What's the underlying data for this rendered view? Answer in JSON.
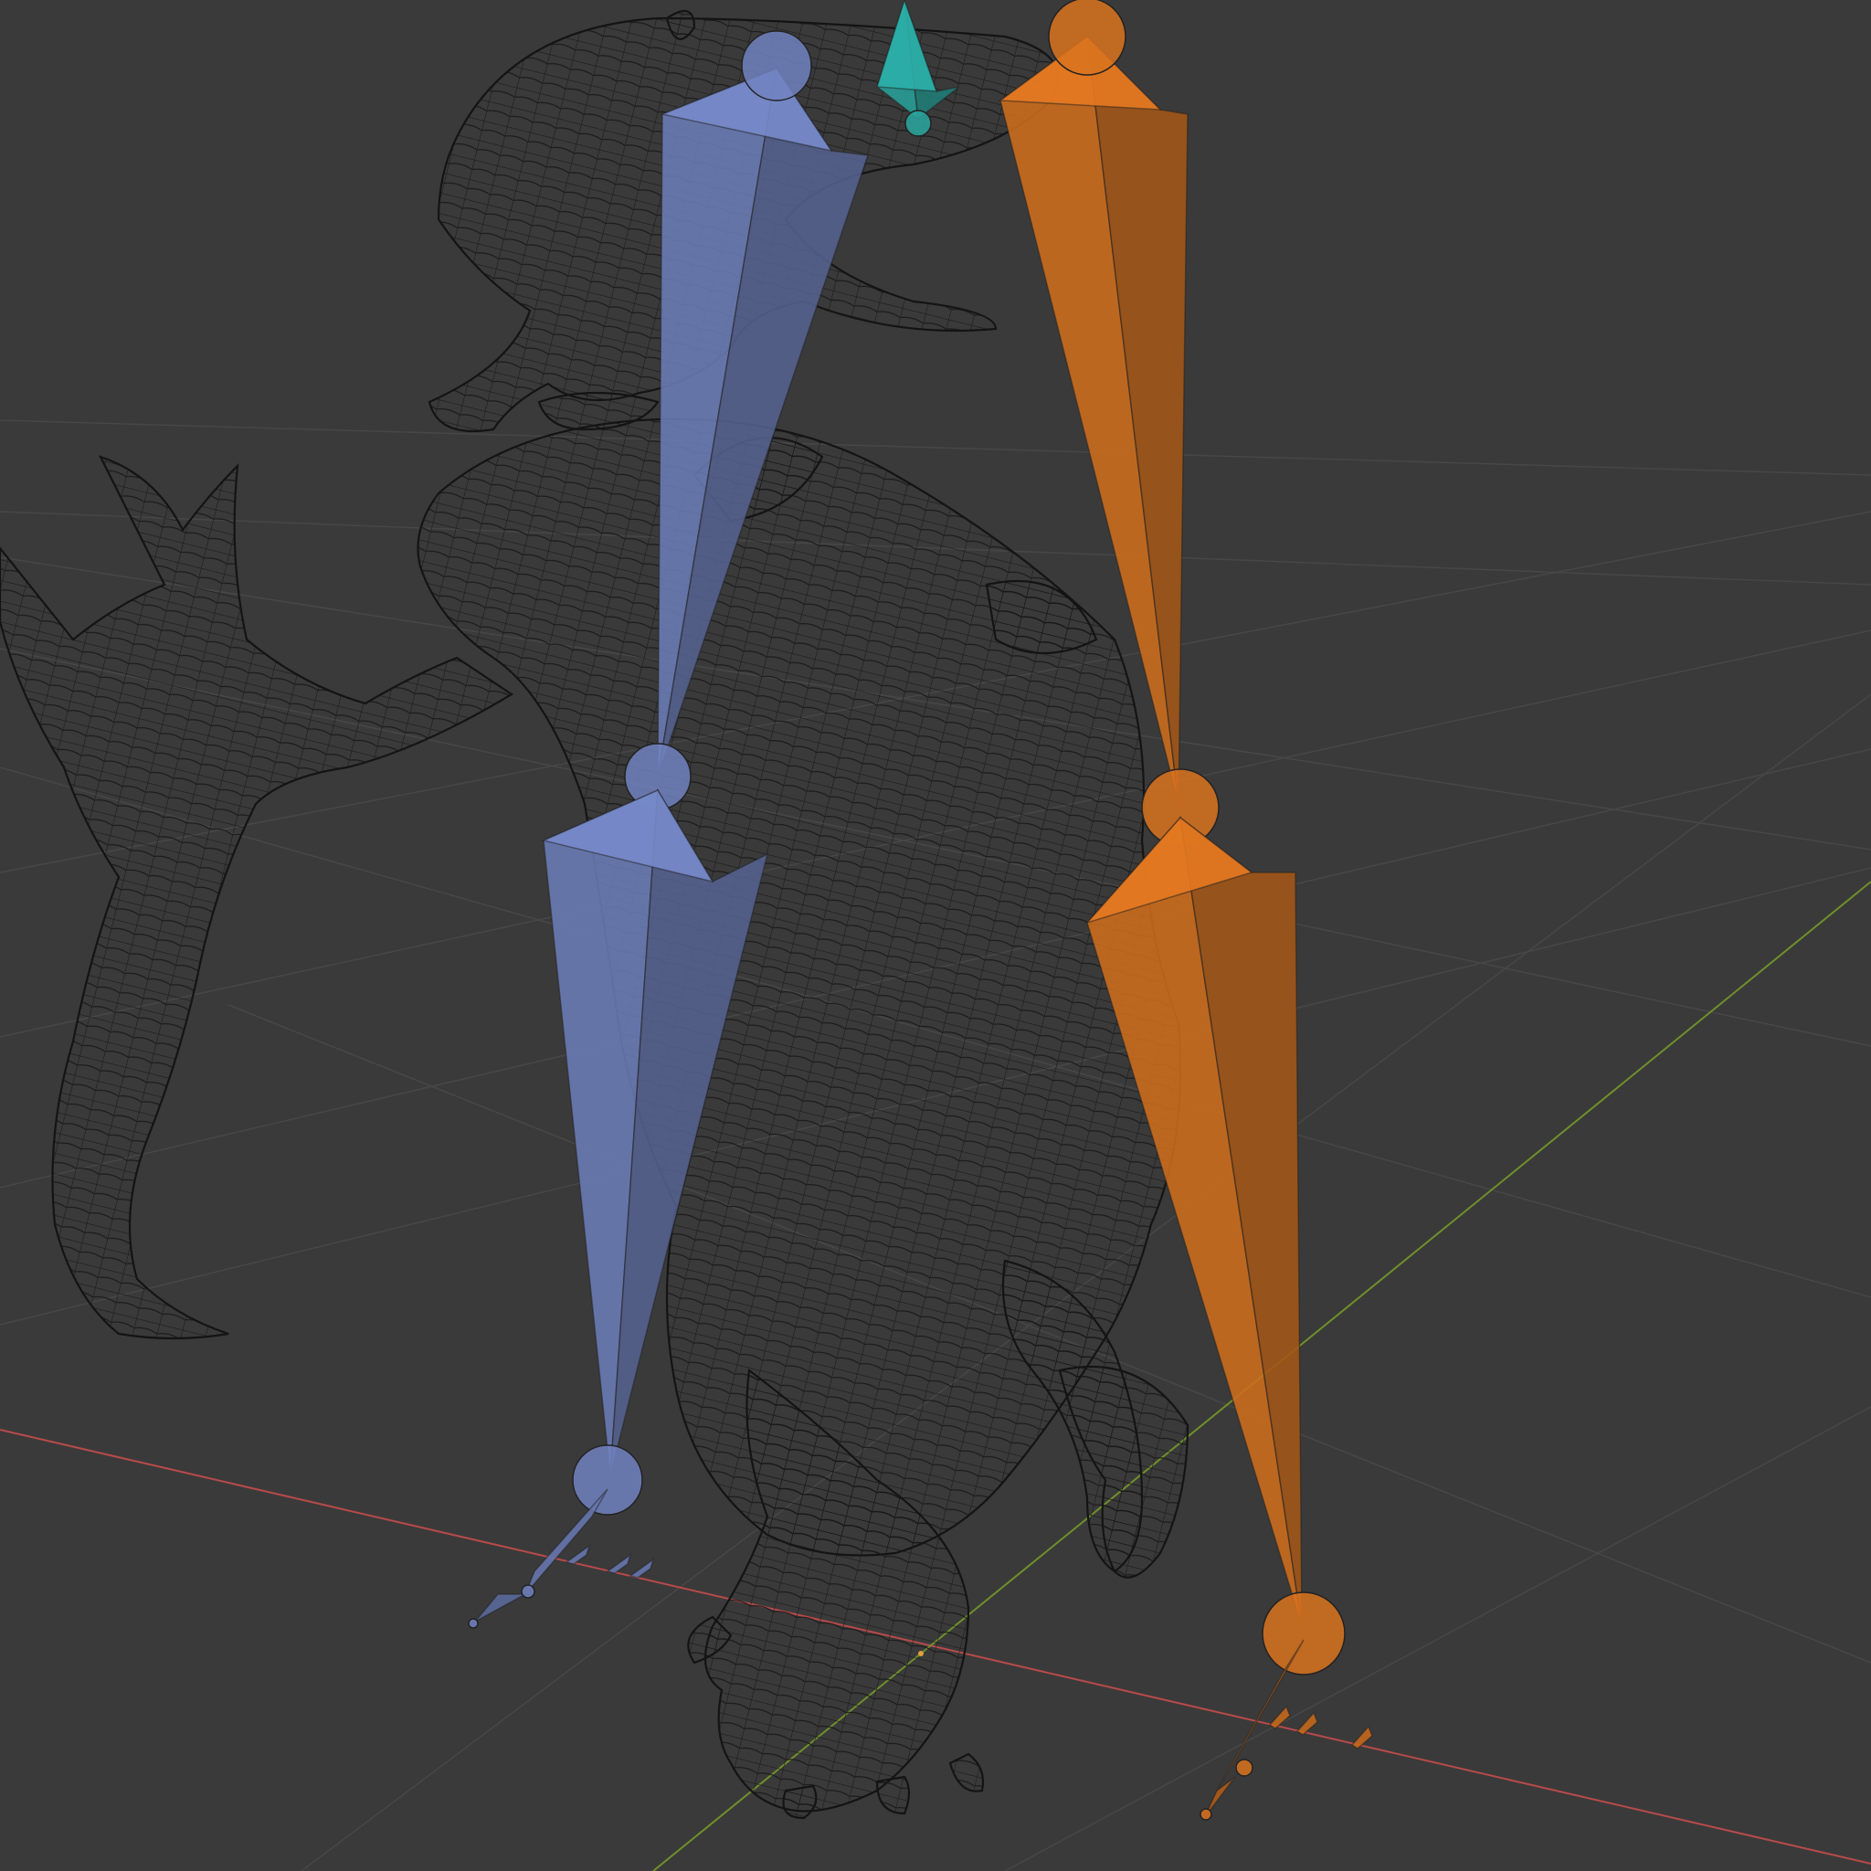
{
  "viewport": {
    "background": "#3a3a3a",
    "grid_color": "#474747",
    "axis_x_color": "#b84a4a",
    "axis_y_color": "#6f8f2a",
    "mesh_color": "#141414"
  },
  "armature": {
    "left_chain_color": "#7183c0",
    "right_chain_color": "#d9731f",
    "root_bone_color": "#2aa7a0",
    "bones": [
      {
        "name": "root-bone",
        "chain": "root"
      },
      {
        "name": "left-thigh-bone",
        "chain": "left"
      },
      {
        "name": "left-shin-bone",
        "chain": "left"
      },
      {
        "name": "left-foot-bone",
        "chain": "left"
      },
      {
        "name": "left-toe-bones",
        "chain": "left"
      },
      {
        "name": "right-thigh-bone",
        "chain": "right"
      },
      {
        "name": "right-shin-bone",
        "chain": "right"
      },
      {
        "name": "right-foot-bone",
        "chain": "right"
      },
      {
        "name": "right-toe-bones",
        "chain": "right"
      }
    ]
  }
}
